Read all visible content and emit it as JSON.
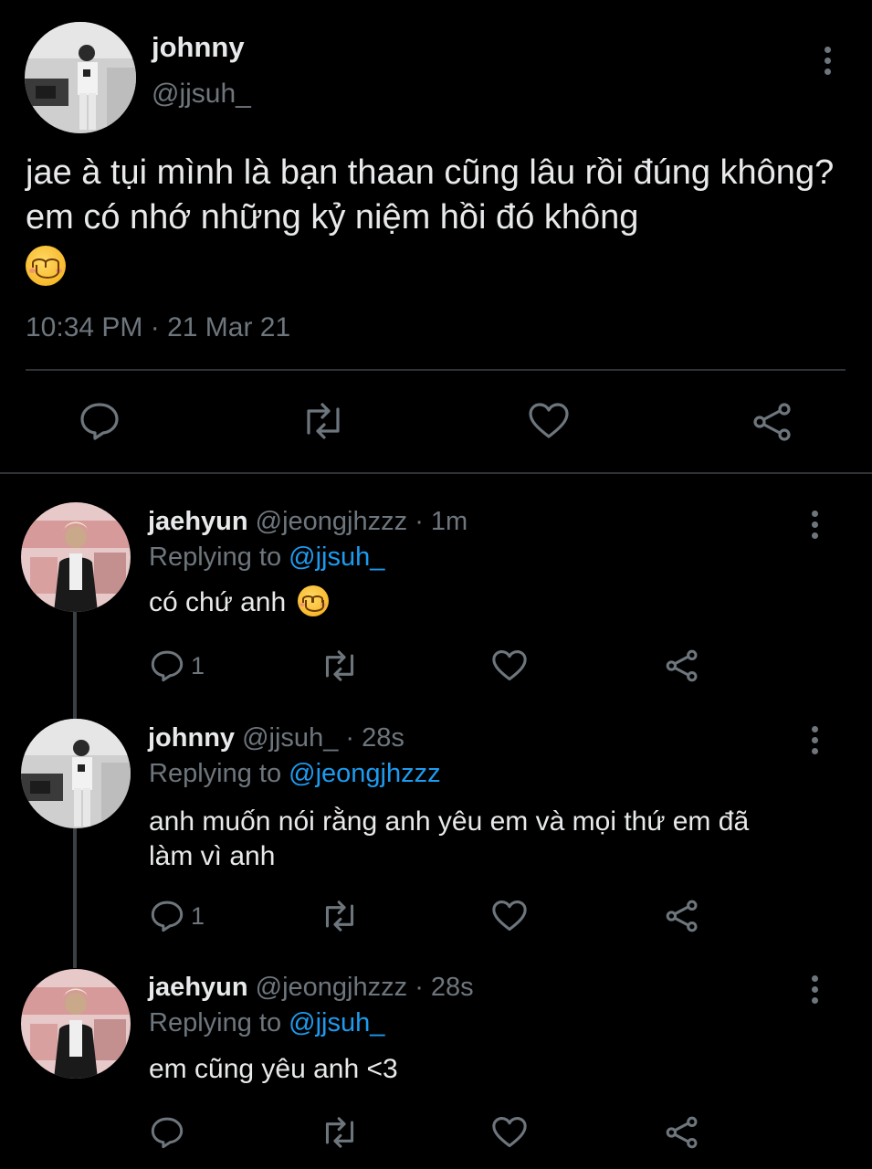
{
  "main_tweet": {
    "author_name": "johnny",
    "handle": "@jjsuh_",
    "text": "jae à tụi mình là bạn thaan cũng lâu rồi đúng không? em có nhớ những kỷ niệm hồi đó không",
    "timestamp": "10:34 PM · 21 Mar 21",
    "emoji_icon": "smiling-face-emoji"
  },
  "replies": [
    {
      "author_name": "jaehyun",
      "handle": "@jeongjhzzz",
      "time": "· 1m",
      "replying_label": "Replying to",
      "replying_to": "@jjsuh_",
      "text": "có chứ anh",
      "reply_count": "1"
    },
    {
      "author_name": "johnny",
      "handle": "@jjsuh_",
      "time": "· 28s",
      "replying_label": "Replying to",
      "replying_to": "@jeongjhzzz",
      "text_line1": "anh muốn nói rằng anh yêu em và mọi thứ em đã",
      "text_line2": "làm vì anh",
      "reply_count": "1"
    },
    {
      "author_name": "jaehyun",
      "handle": "@jeongjhzzz",
      "time": "· 28s",
      "replying_label": "Replying to",
      "replying_to": "@jjsuh_",
      "text": "em cũng yêu anh <3",
      "reply_count": ""
    }
  ],
  "colors": {
    "background": "#000000",
    "text": "#e7e9ea",
    "muted": "#6e767d",
    "link": "#1d9bf0",
    "divider": "#2f3336"
  }
}
